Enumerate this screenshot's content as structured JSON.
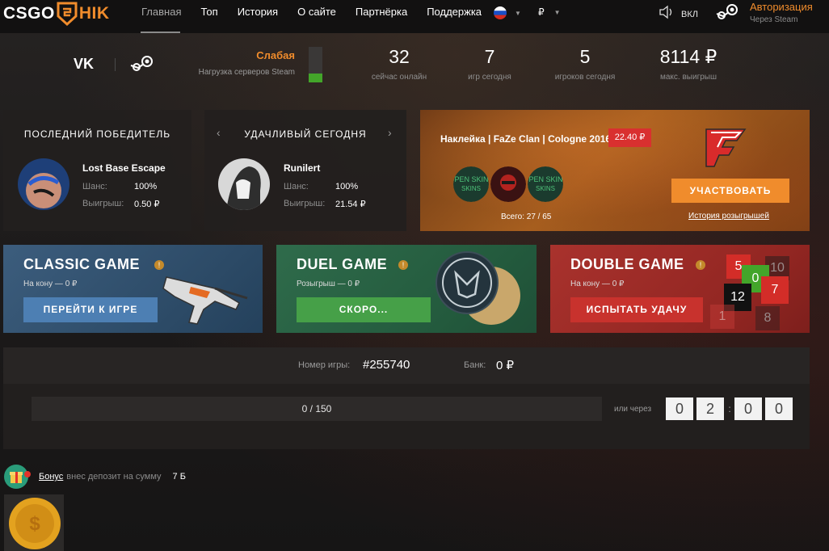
{
  "header": {
    "logo_left": "CSGO",
    "logo_right": "HIK",
    "nav": [
      "Главная",
      "Топ",
      "История",
      "О сайте",
      "Партнёрка",
      "Поддержка"
    ],
    "currency": "₽",
    "sound_label": "ВКЛ",
    "auth_title": "Авторизация",
    "auth_subtitle": "Через Steam"
  },
  "stats": {
    "server_load_value": "Слабая",
    "server_load_label": "Нагрузка серверов Steam",
    "server_load_fraction": 0.25,
    "online": {
      "value": "32",
      "label": "сейчас онлайн"
    },
    "games_today": {
      "value": "7",
      "label": "игр сегодня"
    },
    "players_today": {
      "value": "5",
      "label": "игроков сегодня"
    },
    "max_win": {
      "value": "8114 ₽",
      "label": "макс. выигрыш"
    }
  },
  "last_winner": {
    "title": "ПОСЛЕДНИЙ ПОБЕДИТЕЛЬ",
    "name": "Lost Base Escape",
    "chance_label": "Шанс:",
    "chance": "100%",
    "win_label": "Выигрыш:",
    "win": "0.50 ₽"
  },
  "lucky_today": {
    "title": "УДАЧЛИВЫЙ СЕГОДНЯ",
    "name": "Runilert",
    "chance_label": "Шанс:",
    "chance": "100%",
    "win_label": "Выигрыш:",
    "win": "21.54 ₽"
  },
  "giveaway": {
    "item": "Наклейка | FaZe Clan | Cologne 2016",
    "price": "22.40 ₽",
    "total": "Всего: 27 / 65",
    "join_button": "УЧАСТВОВАТЬ",
    "history_link": "История розыгрышей",
    "chip_texts": [
      "OPEN SKINS",
      "OPEN SKINS"
    ]
  },
  "games": {
    "classic": {
      "title": "CLASSIC GAME",
      "sub": "На кону — 0 ₽",
      "button": "ПЕРЕЙТИ К ИГРЕ"
    },
    "duel": {
      "title": "DUEL GAME",
      "sub": "Розыгрыш — 0 ₽",
      "button": "СКОРО..."
    },
    "double": {
      "title": "DOUBLE GAME",
      "sub": "На кону — 0 ₽",
      "button": "ИСПЫТАТЬ УДАЧУ",
      "tiles": [
        "5",
        "10",
        "0",
        "7",
        "12",
        "1",
        "8"
      ]
    }
  },
  "jackpot": {
    "game_label": "Номер игры:",
    "game_number": "#255740",
    "bank_label": "Банк:",
    "bank": "0 ₽",
    "progress": "0 / 150",
    "timer_label": "или через",
    "timer_digits": [
      "0",
      "2",
      "0",
      "0"
    ]
  },
  "bonus": {
    "link": "Бонус",
    "text": "внес депозит на сумму",
    "amount": "7 Б"
  },
  "colors": {
    "accent": "#f08c2c",
    "red": "#d9302f",
    "green": "#43a52a",
    "classic_panel": "#3c5c7c",
    "duel_panel": "#2f6a4a",
    "double_panel": "#a8302c"
  }
}
